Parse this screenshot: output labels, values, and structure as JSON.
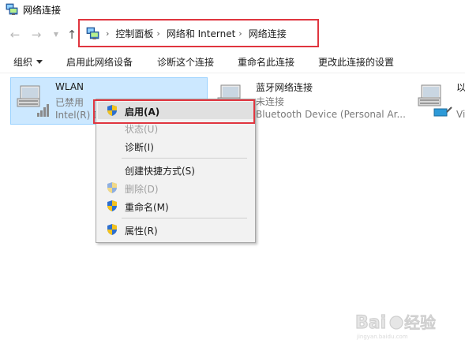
{
  "window": {
    "title": "网络连接"
  },
  "nav": {
    "back": "←",
    "forward": "→",
    "dropdown": "▼",
    "up": "↑"
  },
  "breadcrumb": {
    "items": [
      "控制面板",
      "网络和 Internet",
      "网络连接"
    ],
    "separator": "›"
  },
  "commands": {
    "organize": "组织",
    "enable_device": "启用此网络设备",
    "diagnose": "诊断这个连接",
    "rename": "重命名此连接",
    "change_settings": "更改此连接的设置"
  },
  "adapters": [
    {
      "name": "WLAN",
      "status": "已禁用",
      "device": "Intel(R) D"
    },
    {
      "name": "蓝牙网络连接",
      "status": "未连接",
      "device": "Bluetooth Device (Personal Ar..."
    },
    {
      "name": "以",
      "status": "",
      "device": "Vi"
    }
  ],
  "context_menu": {
    "items": [
      {
        "label": "启用(A)",
        "icon": "uac-shield-icon",
        "disabled": false,
        "bold": true
      },
      {
        "label": "状态(U)",
        "icon": "",
        "disabled": true
      },
      {
        "label": "诊断(I)",
        "icon": "",
        "disabled": false
      },
      {
        "label": "创建快捷方式(S)",
        "icon": "",
        "disabled": false
      },
      {
        "label": "删除(D)",
        "icon": "uac-shield-icon",
        "disabled": true
      },
      {
        "label": "重命名(M)",
        "icon": "uac-shield-icon",
        "disabled": false
      },
      {
        "label": "属性(R)",
        "icon": "uac-shield-icon",
        "disabled": false
      }
    ]
  },
  "watermark": {
    "brand": "Baidu",
    "sub": "经验"
  },
  "colors": {
    "highlight_frame": "#e0353f",
    "selection_bg": "#cce8ff",
    "menu_bg": "#f2f2f2"
  }
}
